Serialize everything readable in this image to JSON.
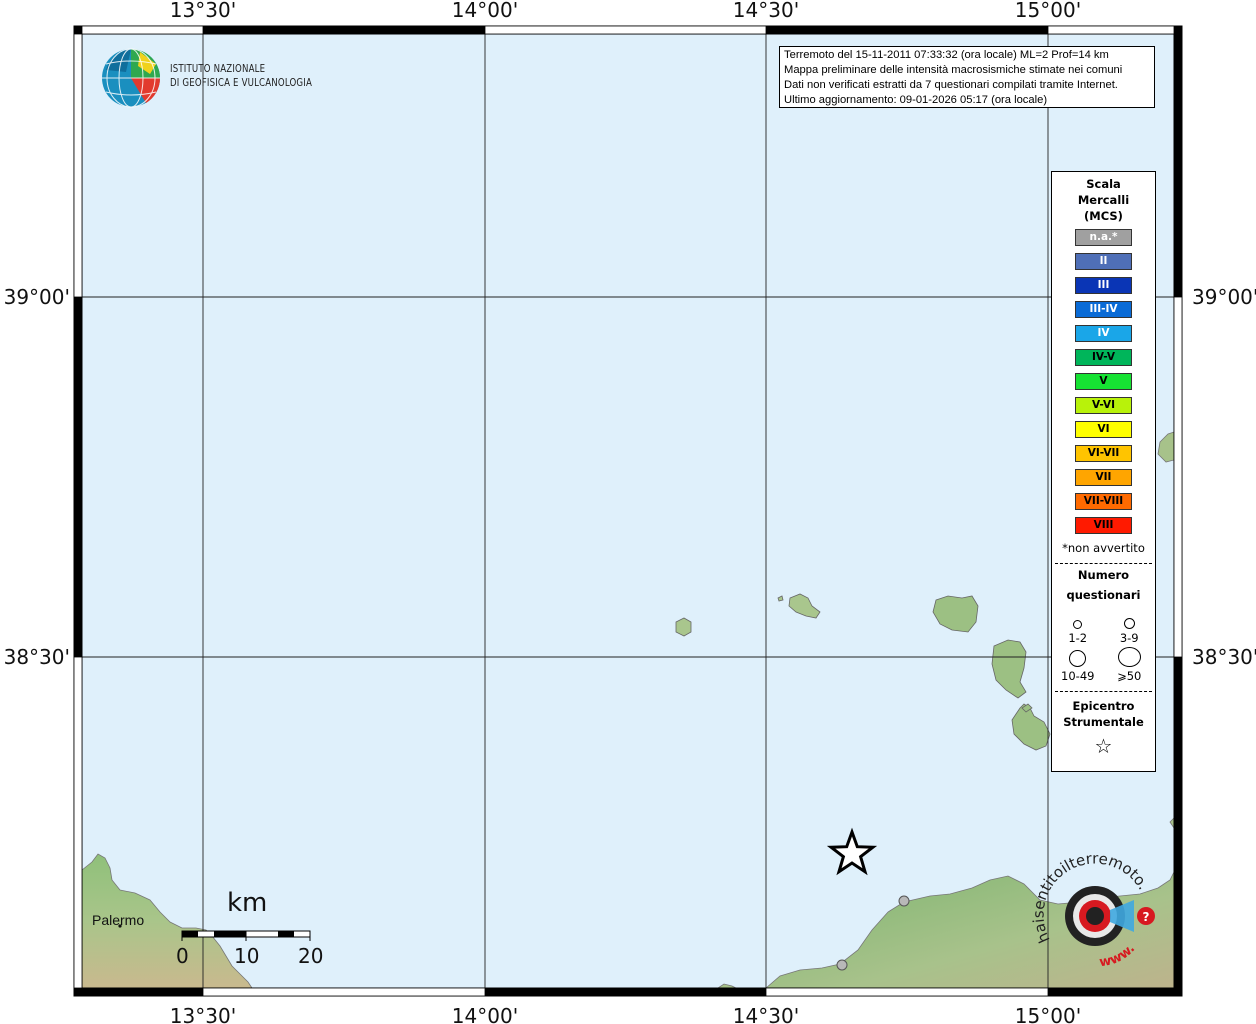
{
  "axes": {
    "lon_labels": [
      "13°30'",
      "14°00'",
      "14°30'",
      "15°00'"
    ],
    "lat_labels": [
      "39°00'",
      "38°30'"
    ]
  },
  "logo": {
    "line1": "ISTITUTO NAZIONALE",
    "line2": "DI GEOFISICA E VULCANOLOGIA",
    "icon": "ingv-globe-logo"
  },
  "info": {
    "line1": "Terremoto del 15-11-2011 07:33:32 (ora locale) ML=2 Prof=14 km",
    "line2": "Mappa preliminare delle intensità macrosismiche stimate nei comuni",
    "line3": "Dati non verificati estratti da 7 questionari compilati tramite Internet.",
    "line4": "Ultimo aggiornamento: 09-01-2026 05:17 (ora locale)"
  },
  "legend": {
    "title_line1": "Scala",
    "title_line2": "Mercalli",
    "title_line3": "(MCS)",
    "scale": [
      {
        "label": "n.a.*",
        "color": "#a0a0a0"
      },
      {
        "label": "II",
        "color": "#4f6fb7"
      },
      {
        "label": "III",
        "color": "#0a35b5"
      },
      {
        "label": "III-IV",
        "color": "#0a6bd6"
      },
      {
        "label": "IV",
        "color": "#1aa6e8"
      },
      {
        "label": "IV-V",
        "color": "#00b55a"
      },
      {
        "label": "V",
        "color": "#16e233"
      },
      {
        "label": "V-VI",
        "color": "#b8f20a"
      },
      {
        "label": "VI",
        "color": "#ffff00"
      },
      {
        "label": "VI-VII",
        "color": "#ffc400"
      },
      {
        "label": "VII",
        "color": "#ffa500"
      },
      {
        "label": "VII-VIII",
        "color": "#ff6a00"
      },
      {
        "label": "VIII",
        "color": "#ff1a00"
      }
    ],
    "footnote": "*non avvertito",
    "questionnaire_title1": "Numero",
    "questionnaire_title2": "questionari",
    "questionnaire_sizes": [
      "1-2",
      "3-9",
      "10-49",
      "⩾50"
    ],
    "epicenter_title1": "Epicentro",
    "epicenter_title2": "Strumentale",
    "star_icon": "☆"
  },
  "places": {
    "palermo": "Palermo"
  },
  "scale_bar": {
    "unit": "km",
    "ticks": [
      "0",
      "10",
      "20"
    ]
  },
  "badge": {
    "text": "haisentitoilterremoto.it",
    "url": "www.",
    "icon": "haisentito-target-logo"
  }
}
